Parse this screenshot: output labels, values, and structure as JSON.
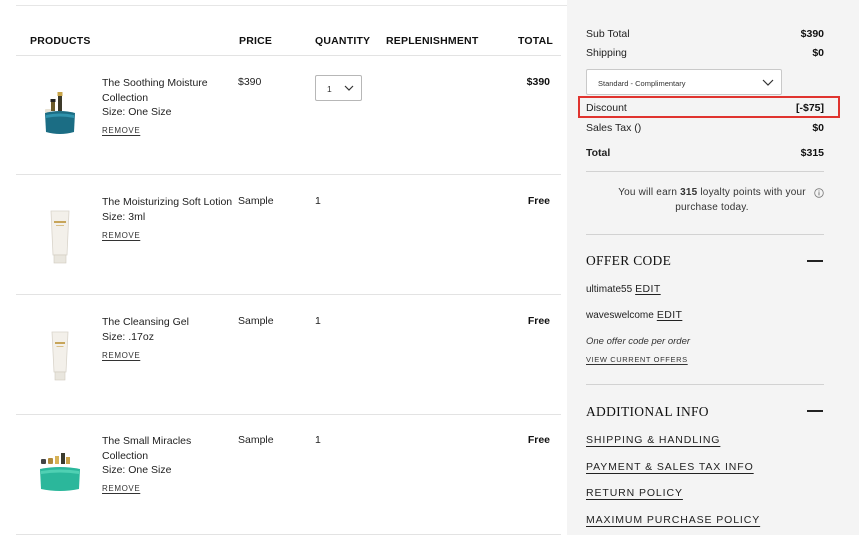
{
  "cart": {
    "headers": {
      "products": "PRODUCTS",
      "price": "PRICE",
      "quantity": "QUANTITY",
      "replenishment": "REPLENISHMENT",
      "total": "TOTAL"
    },
    "items": [
      {
        "name": "The Soothing Moisture Collection",
        "size": "Size: One Size",
        "remove": "REMOVE",
        "price": "$390",
        "quantity": "1",
        "total": "$390",
        "image": "product-set-teal-pouch"
      },
      {
        "name": "The Moisturizing Soft Lotion",
        "size": "Size: 3ml",
        "remove": "REMOVE",
        "price": "Sample",
        "quantity": "1",
        "total": "Free",
        "image": "cream-tube"
      },
      {
        "name": "The Cleansing Gel",
        "size": "Size: .17oz",
        "remove": "REMOVE",
        "price": "Sample",
        "quantity": "1",
        "total": "Free",
        "image": "cream-tube"
      },
      {
        "name": "The Small Miracles Collection",
        "size": "Size: One Size",
        "remove": "REMOVE",
        "price": "Sample",
        "quantity": "1",
        "total": "Free",
        "image": "product-set-green-pouch"
      }
    ]
  },
  "summary": {
    "subtotal_label": "Sub Total",
    "subtotal_value": "$390",
    "shipping_label": "Shipping",
    "shipping_value": "$0",
    "shipping_method": "Standard - Complimentary",
    "discount_label": "Discount",
    "discount_value": "[-$75]",
    "tax_label": "Sales Tax ()",
    "tax_value": "$0",
    "total_label": "Total",
    "total_value": "$315",
    "loyalty_prefix": "You will earn ",
    "loyalty_points": "315",
    "loyalty_suffix": " loyalty points with your purchase today.",
    "highlight_color": "#e0342f"
  },
  "offer": {
    "title": "OFFER CODE",
    "codes": [
      {
        "code": "ultimate55",
        "edit": "EDIT"
      },
      {
        "code": "waveswelcome",
        "edit": "EDIT"
      }
    ],
    "note": "One offer code per order",
    "view_offers": "VIEW CURRENT OFFERS"
  },
  "additional": {
    "title": "ADDITIONAL INFO",
    "links": [
      "SHIPPING & HANDLING",
      "PAYMENT & SALES TAX INFO",
      "RETURN POLICY",
      "MAXIMUM PURCHASE POLICY"
    ]
  }
}
